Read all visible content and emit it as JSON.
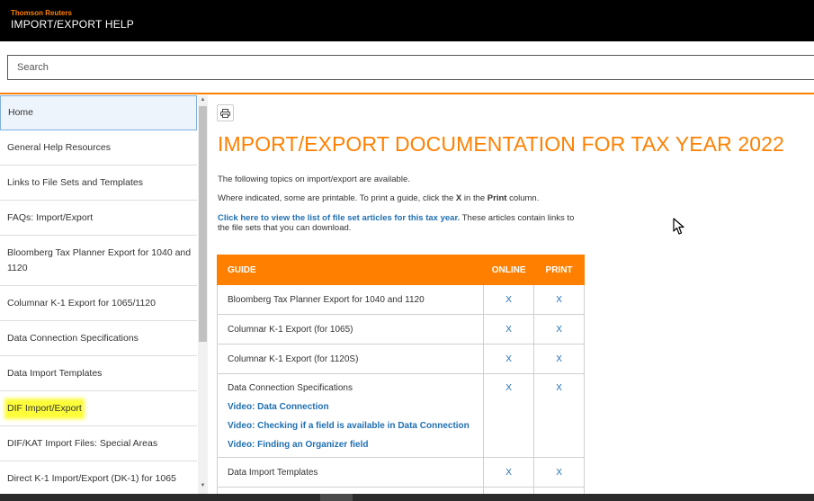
{
  "header": {
    "brand": "Thomson Reuters",
    "title": "IMPORT/EXPORT HELP"
  },
  "search": {
    "placeholder": "Search"
  },
  "sidebar": {
    "items": [
      {
        "label": "Home",
        "active": true
      },
      {
        "label": "General Help Resources"
      },
      {
        "label": "Links to File Sets and Templates"
      },
      {
        "label": "FAQs: Import/Export"
      },
      {
        "label": "Bloomberg Tax Planner Export for 1040 and 1120"
      },
      {
        "label": "Columnar K-1 Export for 1065/1120"
      },
      {
        "label": "Data Connection Specifications"
      },
      {
        "label": "Data Import Templates"
      },
      {
        "label": "DIF Import/Export",
        "highlighted": true
      },
      {
        "label": "DIF/KAT Import Files: Special Areas"
      },
      {
        "label": "Direct K-1 Import/Export (DK-1) for 1065"
      }
    ]
  },
  "main": {
    "title": "IMPORT/EXPORT DOCUMENTATION FOR TAX YEAR 2022",
    "intro": "The following topics on import/export are available.",
    "print_instruction": {
      "before": "Where indicated, some are printable. To print a guide, click the ",
      "x": "X",
      "middle": " in the ",
      "print": "Print",
      "after": " column."
    },
    "fileset_link": "Click here to view the list of file set articles for this tax year.",
    "fileset_rest": " These articles contain links to the file sets that you can download."
  },
  "table": {
    "headers": {
      "guide": "GUIDE",
      "online": "ONLINE",
      "print": "PRINT"
    },
    "rows": [
      {
        "guide": "Bloomberg Tax Planner Export for 1040 and 1120",
        "online": "X",
        "print": "X"
      },
      {
        "guide": "Columnar K-1 Export (for 1065)",
        "online": "X",
        "print": "X"
      },
      {
        "guide": "Columnar K-1 Export (for 1120S)",
        "online": "X",
        "print": "X"
      },
      {
        "guide": "Data Connection Specifications",
        "online": "X",
        "print": "X",
        "videos": [
          "Video: Data Connection",
          "Video: Checking if a field is available in Data Connection",
          "Video: Finding an Organizer field"
        ]
      },
      {
        "guide": "Data Import Templates",
        "online": "X",
        "print": "X"
      }
    ]
  },
  "colors": {
    "accent": "#ff8000",
    "link": "#1f6fb2",
    "highlight": "#fdfd3a",
    "header_bg": "#000000"
  },
  "icons": {
    "print": "printer-icon",
    "cursor": "mouse-pointer-icon"
  }
}
